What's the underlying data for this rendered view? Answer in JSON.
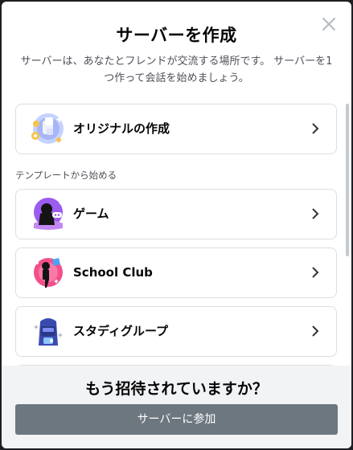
{
  "modal": {
    "title": "サーバーを作成",
    "subtitle": "サーバーは、あなたとフレンドが交流する場所です。 サーバーを1つ作って会話を始めましょう。",
    "close_icon": "close-icon"
  },
  "options": {
    "create_own": {
      "label": "オリジナルの作成",
      "icon": "server-create-art"
    },
    "section_label": "テンプレートから始める",
    "templates": [
      {
        "label": "ゲーム",
        "icon": "gaming-art"
      },
      {
        "label": "School Club",
        "icon": "school-club-art"
      },
      {
        "label": "スタディグループ",
        "icon": "study-group-art"
      }
    ]
  },
  "footer": {
    "title": "もう招待されていますか？",
    "join_label": "サーバーに参加"
  },
  "colors": {
    "join_button": "#6d7780",
    "footer_bg": "#f2f3f5",
    "card_border": "#dcdee1"
  }
}
